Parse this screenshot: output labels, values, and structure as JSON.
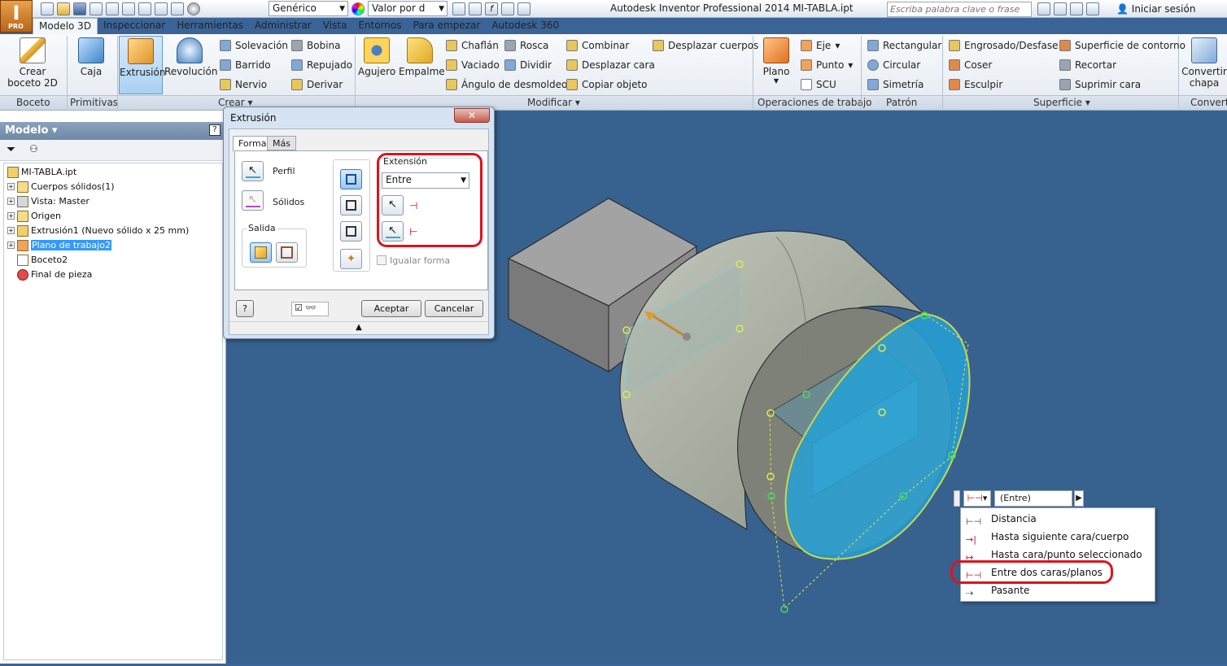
{
  "app": {
    "logo_letter": "I",
    "logo_sub": "PRO",
    "title": "Autodesk Inventor Professional 2014    MI-TABLA.ipt",
    "search_placeholder": "Escriba palabra clave o frase",
    "signin": "Iniciar sesión"
  },
  "qat": {
    "material_combo": "Genérico",
    "appearance_combo": "Valor por d"
  },
  "tabs": [
    "Modelo 3D",
    "Inspeccionar",
    "Herramientas",
    "Administrar",
    "Vista",
    "Entornos",
    "Para empezar",
    "Autodesk 360"
  ],
  "ribbon": {
    "boceto": {
      "label": "Boceto",
      "create_sketch": "Crear\nboceto 2D"
    },
    "primitivas": {
      "label": "Primitivas",
      "caja": "Caja"
    },
    "crear": {
      "label": "Crear",
      "extrusion": "Extrusión",
      "revolucion": "Revolución",
      "solevacion": "Solevación",
      "barrido": "Barrido",
      "nervio": "Nervio",
      "bobina": "Bobina",
      "repujado": "Repujado",
      "derivar": "Derivar",
      "agujero": "Agujero",
      "empalme": "Empalme"
    },
    "modificar": {
      "label": "Modificar",
      "chaflan": "Chaflán",
      "vaciado": "Vaciado",
      "angulo": "Ángulo de desmoldeo",
      "rosca": "Rosca",
      "dividir": "Dividir",
      "combinar": "Combinar",
      "desplazar_cara": "Desplazar cara",
      "copiar_objeto": "Copiar objeto",
      "desplazar_cuerpos": "Desplazar cuerpos"
    },
    "operaciones": {
      "label": "Operaciones de trabajo",
      "plano": "Plano",
      "eje": "Eje",
      "punto": "Punto",
      "scu": "SCU"
    },
    "patron": {
      "label": "Patrón",
      "rectangular": "Rectangular",
      "circular": "Circular",
      "simetria": "Simetría"
    },
    "superficie": {
      "label": "Superficie",
      "engrosado": "Engrosado/Desfase",
      "coser": "Coser",
      "esculpir": "Esculpir",
      "contorno": "Superficie de contorno",
      "recortar": "Recortar",
      "suprimir": "Suprimir cara"
    },
    "convertir": {
      "label": "Converti",
      "btn": "Convertir\nchapa"
    }
  },
  "browser": {
    "title": "Modelo",
    "items": [
      "MI-TABLA.ipt",
      "Cuerpos sólidos(1)",
      "Vista: Master",
      "Origen",
      "Extrusión1 (Nuevo sólido x 25 mm)",
      "Plano de trabajo2",
      "Boceto2",
      "Final de pieza"
    ]
  },
  "dialog": {
    "title": "Extrusión",
    "close": "✕",
    "tab_forma": "Forma",
    "tab_mas": "Más",
    "perfil": "Perfil",
    "solidos": "Sólidos",
    "salida": "Salida",
    "extension_label": "Extensión",
    "extension_value": "Entre",
    "igualar_forma": "Igualar forma",
    "ok": "Aceptar",
    "cancel": "Cancelar"
  },
  "minitoolbar": {
    "value": "(Entre)"
  },
  "extent_menu": [
    "Distancia",
    "Hasta siguiente cara/cuerpo",
    "Hasta cara/punto seleccionado",
    "Entre dos caras/planos",
    "Pasante"
  ]
}
